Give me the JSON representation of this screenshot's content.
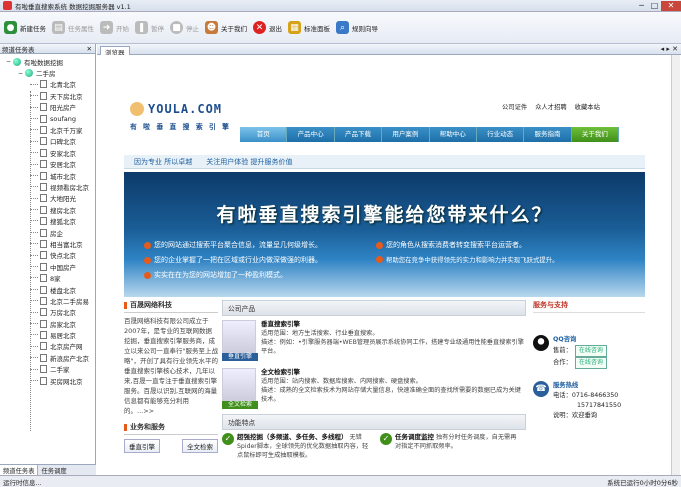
{
  "window": {
    "title": "有啦垂直搜索系统 数据挖掘服务器 v1.1",
    "minimize": "─",
    "maximize": "□",
    "close": "✕"
  },
  "toolbar": {
    "items": [
      {
        "label": "新建任务",
        "icon": "new-task-icon",
        "enabled": true
      },
      {
        "label": "任务属性",
        "icon": "task-properties-icon",
        "enabled": false
      },
      {
        "label": "开始",
        "icon": "start-icon",
        "enabled": false
      },
      {
        "label": "暂停",
        "icon": "pause-icon",
        "enabled": false
      },
      {
        "label": "停止",
        "icon": "stop-icon",
        "enabled": false
      },
      {
        "label": "关于我们",
        "icon": "about-icon",
        "enabled": true
      },
      {
        "label": "退出",
        "icon": "exit-icon",
        "enabled": true
      },
      {
        "label": "标准面板",
        "icon": "standard-panel-icon",
        "enabled": true
      },
      {
        "label": "规则向导",
        "icon": "rule-wizard-icon",
        "enabled": true
      }
    ]
  },
  "sidebar": {
    "title": "频道任务表",
    "root": "有啦数据挖掘",
    "group": "二手房",
    "items": [
      "北青北京",
      "天下房北京",
      "阳光房产",
      "soufang",
      "北京千万家",
      "口碑北京",
      "安家北京",
      "安居北京",
      "城市北京",
      "视频看房北京",
      "大地阳光",
      "搜房北京",
      "搜狐北京",
      "房企",
      "相当富北京",
      "快点北京",
      "中国房产",
      "8家",
      "楼盘北京",
      "北京二手房易",
      "万房北京",
      "房家北京",
      "易居北京",
      "北京房产网",
      "新浪房产北京",
      "二手家",
      "买房网北京"
    ],
    "tabs": [
      "频道任务表",
      "任务调度"
    ]
  },
  "browser": {
    "tab": "浏览器"
  },
  "website": {
    "logo": "YOULA.COM",
    "tagline": "有 啦 垂 直 搜 索 引 擎",
    "toplinks": [
      "公司证件",
      "众人才招聘",
      "收藏本站"
    ],
    "nav": [
      "首页",
      "产品中心",
      "产品下载",
      "用户案例",
      "帮助中心",
      "行业动态",
      "服务指南",
      "关于我们"
    ],
    "subbar": [
      "因为专业 所以卓越",
      "关注用户体验 提升服务价值"
    ],
    "banner": {
      "slogan": "有啦垂直搜索引擎能给您带来什么？",
      "lines": [
        {
          "a": "您的网站通过搜索平台聚合信息，流量呈几何级增长。",
          "b": "您的角色从搜索消费者转变搜索平台运营者。"
        },
        {
          "a": "您的企业掌握了一把在区域或行业内做深做强的利器。",
          "b": "帮助您在竞争中获得领先的实力和影响力并实现飞跃式提升。"
        },
        {
          "a": "实实在在为您的网站增加了一种盈利模式。",
          "b": ""
        }
      ]
    },
    "company": {
      "title": "百晟网络科技",
      "text": "百晟网络科技有限公司成立于2007年，是专业的互联网数据挖掘，垂直搜索引擎服务商，成立以来公司一直奉行\"服务至上战略\"，开创了具有行业领先水平的垂直搜索引擎核心技术，几年以来,百晟一直专注于垂直搜索引擎服务。百晟以识别,互联网的海量信息都有能够充分利用的。...>>",
      "biz_title": "业务和服务",
      "biz_buttons": [
        "垂直引擎",
        "全文检索"
      ]
    },
    "products": {
      "title": "公司产品",
      "items": [
        {
          "name": "垂直搜索引擎",
          "img_label": "垂直引擎",
          "use": "适用范围：地方生活搜索、行业垂直搜索。",
          "desc": "描述：例如：•引擎服务器端•WEB管理员展示系统协同工作，搭建专业级通用性能垂直搜索引擎平台。"
        },
        {
          "name": "全文检索引擎",
          "img_label": "全文检索",
          "use": "适用范围：站内搜索、数据库搜索、内网搜索、硬盘搜索。",
          "desc": "描述：成熟的全文检索技术为网站存储大量信息，快速准确全面的查找所需要的数据已成为关键技术。"
        }
      ]
    },
    "features": {
      "title": "功能特点",
      "f1_title": "超强挖掘（多频道、多任务、多线程）",
      "f1_text": "无错Spider脚本，全球领先的优化数据抽取内容，轻点鼠标即可生成抽取模板。",
      "f2_title": "任务调度监控",
      "f2_text": "独有分时任务调度，自无需再对指定不同抓取频率。"
    },
    "support": {
      "title": "服务与支持",
      "qq_title": "QQ咨询",
      "qq_rows": [
        "售前：",
        "合作："
      ],
      "online": "在线咨询",
      "phone_title": "服务热线",
      "phones": [
        "电话：0716-8466350",
        "15717841550"
      ],
      "email": "说明：欢迎垂询"
    }
  },
  "status": {
    "left": "运行时信息...",
    "right": "系统已运行0小时0分6秒"
  }
}
